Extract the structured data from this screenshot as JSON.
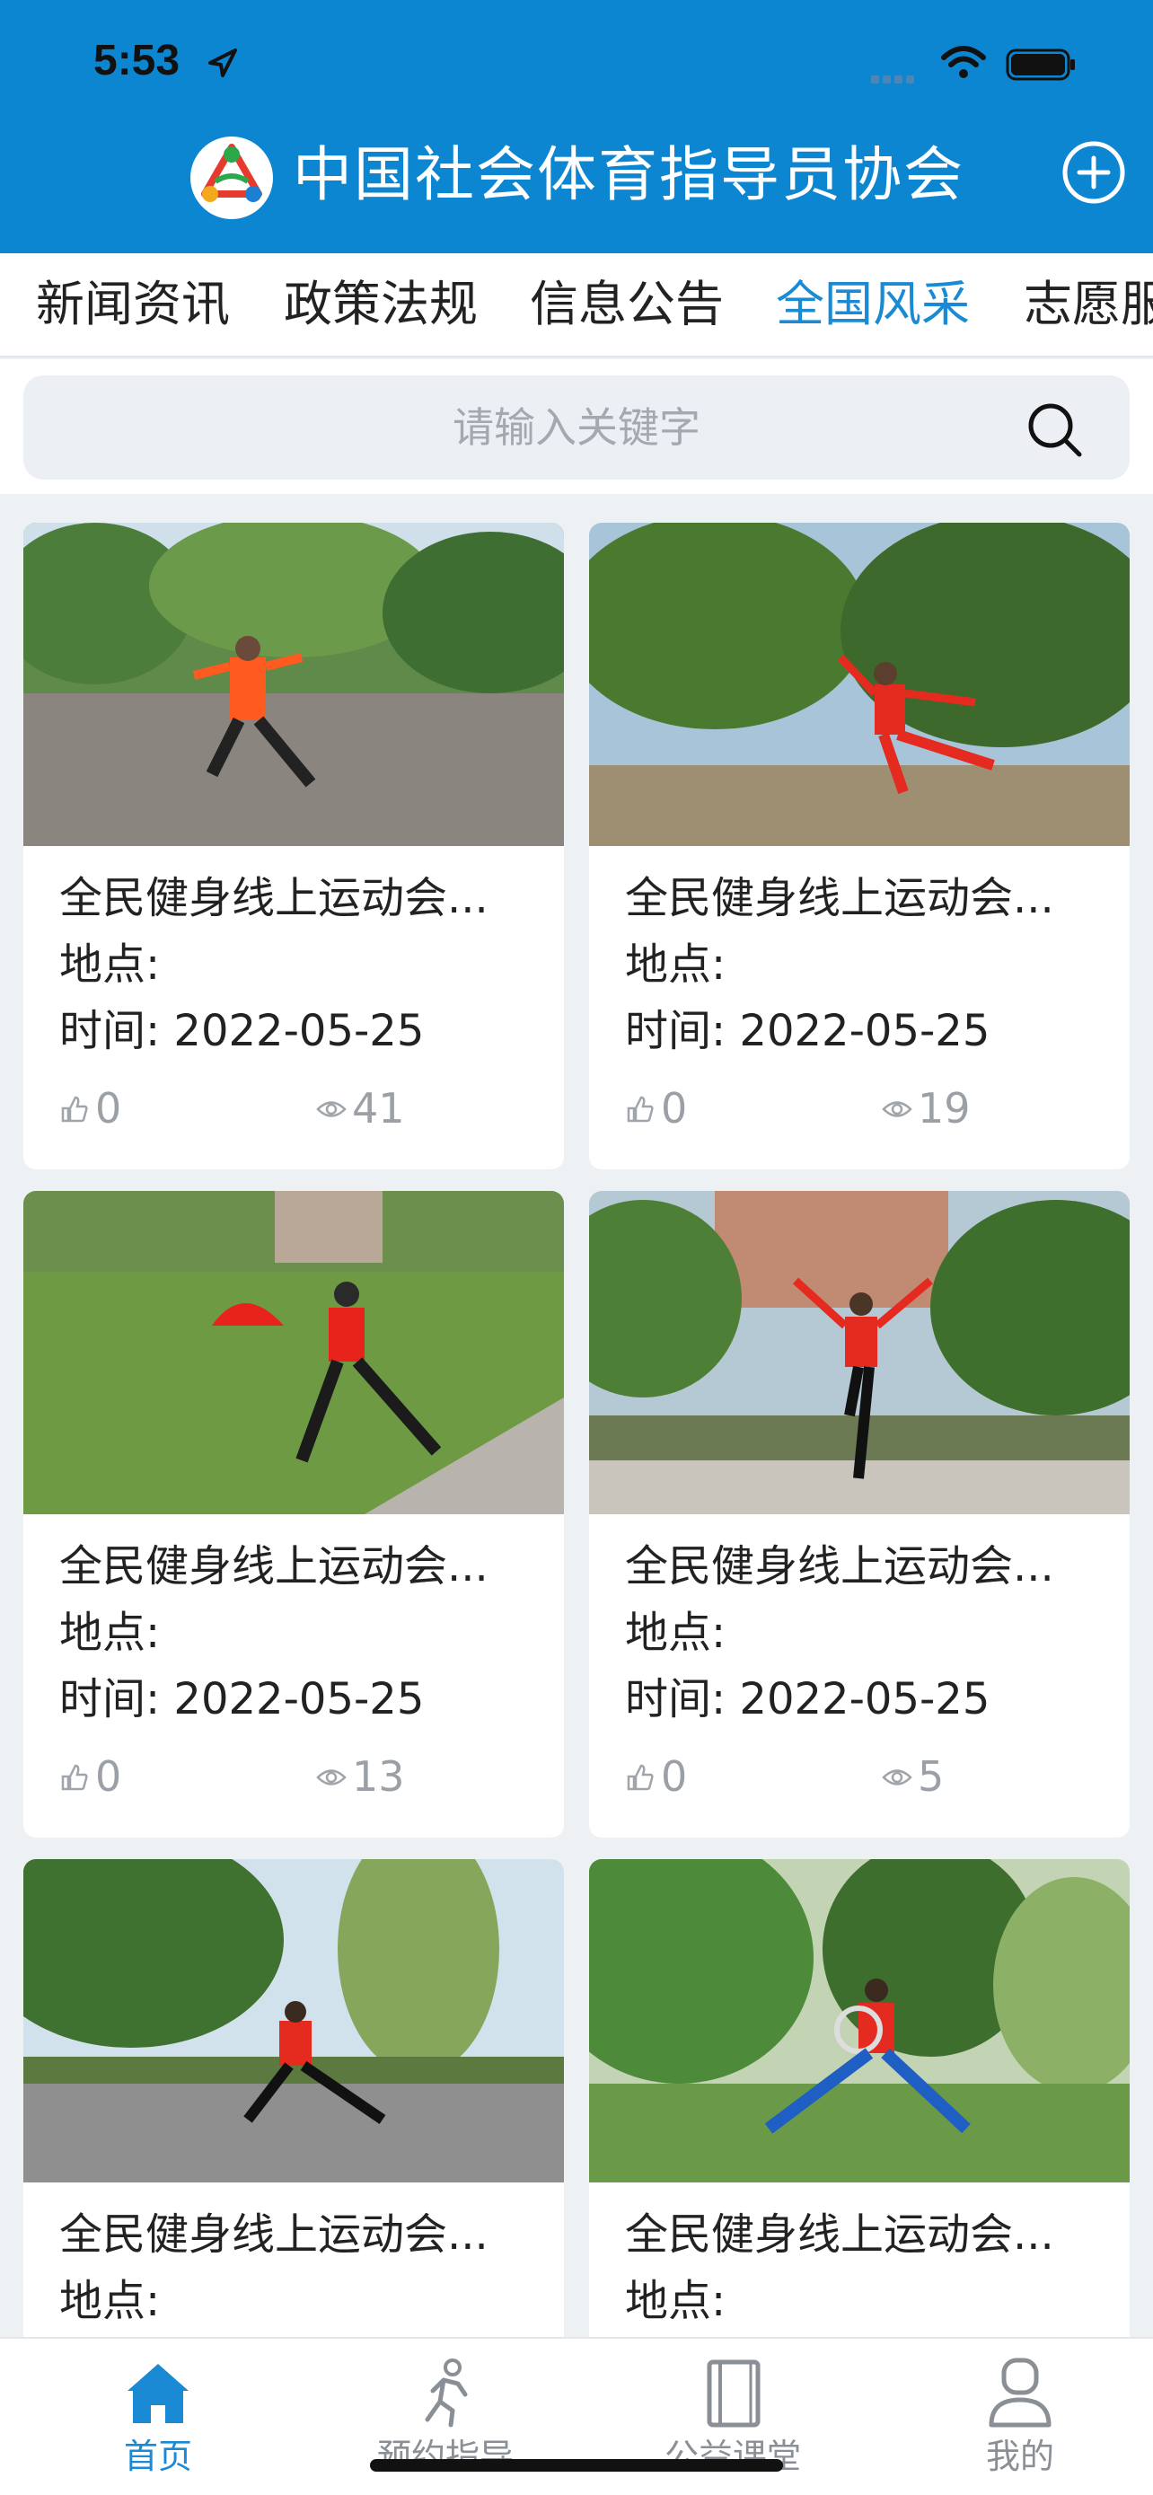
{
  "status_bar": {
    "time": "5:53"
  },
  "header": {
    "title": "中国社会体育指导员协会"
  },
  "tabs": [
    {
      "label": "新闻资讯",
      "active": false
    },
    {
      "label": "政策法规",
      "active": false
    },
    {
      "label": "信息公告",
      "active": false
    },
    {
      "label": "全国风采",
      "active": true
    },
    {
      "label": "志愿服务",
      "active": false
    }
  ],
  "search": {
    "placeholder": "请输入关键字"
  },
  "cards": [
    {
      "title": "全民健身线上运动会...",
      "place": "地点:",
      "time": "时间: 2022-05-25",
      "likes": "0",
      "views": "41"
    },
    {
      "title": "全民健身线上运动会...",
      "place": "地点:",
      "time": "时间: 2022-05-25",
      "likes": "0",
      "views": "19"
    },
    {
      "title": "全民健身线上运动会...",
      "place": "地点:",
      "time": "时间: 2022-05-25",
      "likes": "0",
      "views": "13"
    },
    {
      "title": "全民健身线上运动会...",
      "place": "地点:",
      "time": "时间: 2022-05-25",
      "likes": "0",
      "views": "5"
    },
    {
      "title": "全民健身线上运动会...",
      "place": "地点:",
      "time": "",
      "likes": "",
      "views": ""
    },
    {
      "title": "全民健身线上运动会...",
      "place": "地点:",
      "time": "",
      "likes": "",
      "views": ""
    }
  ],
  "tabbar": [
    {
      "label": "首页",
      "icon": "home-icon",
      "active": true
    },
    {
      "label": "预约指导",
      "icon": "runner-icon",
      "active": false
    },
    {
      "label": "公益课堂",
      "icon": "book-icon",
      "active": false
    },
    {
      "label": "我的",
      "icon": "profile-icon",
      "active": false
    }
  ],
  "colors": {
    "primary": "#0d86d2",
    "active_tab": "#1a8ad4",
    "background": "#eef1f4"
  }
}
